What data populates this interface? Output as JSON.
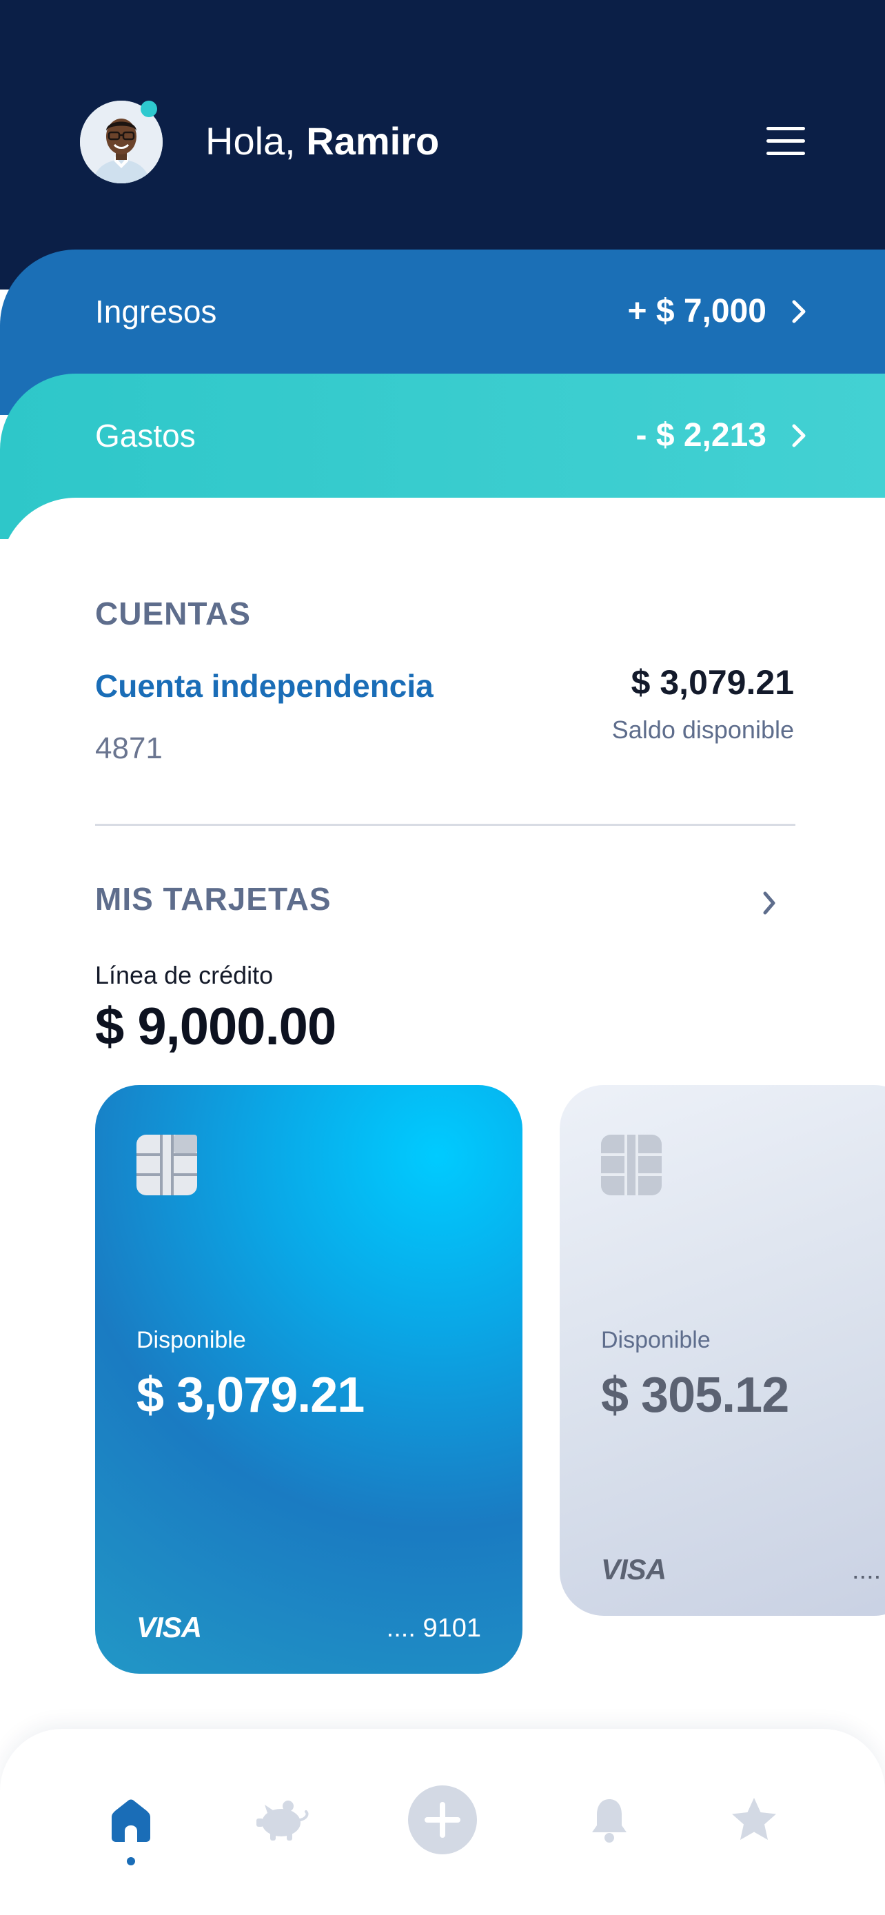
{
  "header": {
    "greeting_prefix": "Hola,",
    "user_name": "Ramiro"
  },
  "summary": {
    "income": {
      "label": "Ingresos",
      "amount": "+ $ 7,000"
    },
    "expenses": {
      "label": "Gastos",
      "amount": "- $ 2,213"
    }
  },
  "accounts": {
    "title": "CUENTAS",
    "items": [
      {
        "name": "Cuenta independencia",
        "number": "4871",
        "balance": "$ 3,079.21",
        "balance_label": "Saldo disponible"
      }
    ]
  },
  "cards": {
    "title": "MIS TARJETAS",
    "credit_line_label": "Línea de crédito",
    "credit_line_value": "$ 9,000.00",
    "items": [
      {
        "available_label": "Disponible",
        "available_value": "$ 3,079.21",
        "brand": "VISA",
        "last_digits": ".... 9101"
      },
      {
        "available_label": "Disponible",
        "available_value": "$ 305.12",
        "brand": "VISA",
        "last_digits": "...."
      }
    ]
  },
  "bottom_nav": {
    "items": [
      {
        "icon": "home-icon",
        "active": true
      },
      {
        "icon": "piggy-bank-icon",
        "active": false
      },
      {
        "icon": "plus-circle-icon",
        "active": false
      },
      {
        "icon": "bell-icon",
        "active": false
      },
      {
        "icon": "star-icon",
        "active": false
      }
    ]
  },
  "colors": {
    "header_bg": "#0b1f47",
    "income_band": "#1b6fb6",
    "expense_band": "#2ec7c9",
    "accent_blue": "#1a6db7",
    "muted_text": "#5e6d8c",
    "nav_inactive": "#d3d9e4"
  }
}
